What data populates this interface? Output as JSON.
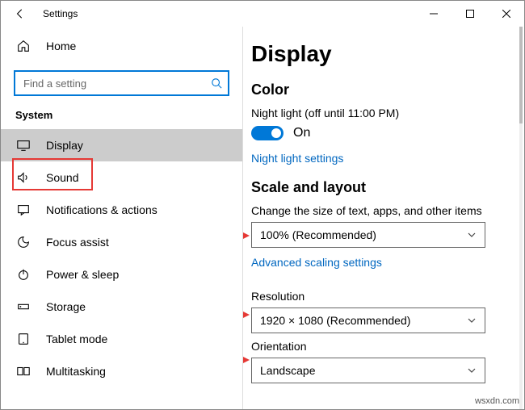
{
  "window": {
    "title": "Settings"
  },
  "sidebar": {
    "home": "Home",
    "search_placeholder": "Find a setting",
    "group": "System",
    "items": [
      {
        "label": "Display"
      },
      {
        "label": "Sound"
      },
      {
        "label": "Notifications & actions"
      },
      {
        "label": "Focus assist"
      },
      {
        "label": "Power & sleep"
      },
      {
        "label": "Storage"
      },
      {
        "label": "Tablet mode"
      },
      {
        "label": "Multitasking"
      }
    ]
  },
  "main": {
    "heading": "Display",
    "color_heading": "Color",
    "night_light_status": "Night light (off until 11:00 PM)",
    "toggle_state": "On",
    "night_light_link": "Night light settings",
    "scale_heading": "Scale and layout",
    "scale_label": "Change the size of text, apps, and other items",
    "scale_value": "100% (Recommended)",
    "advanced_link": "Advanced scaling settings",
    "resolution_label": "Resolution",
    "resolution_value": "1920 × 1080 (Recommended)",
    "orientation_label": "Orientation",
    "orientation_value": "Landscape"
  },
  "watermark": "wsxdn.com"
}
